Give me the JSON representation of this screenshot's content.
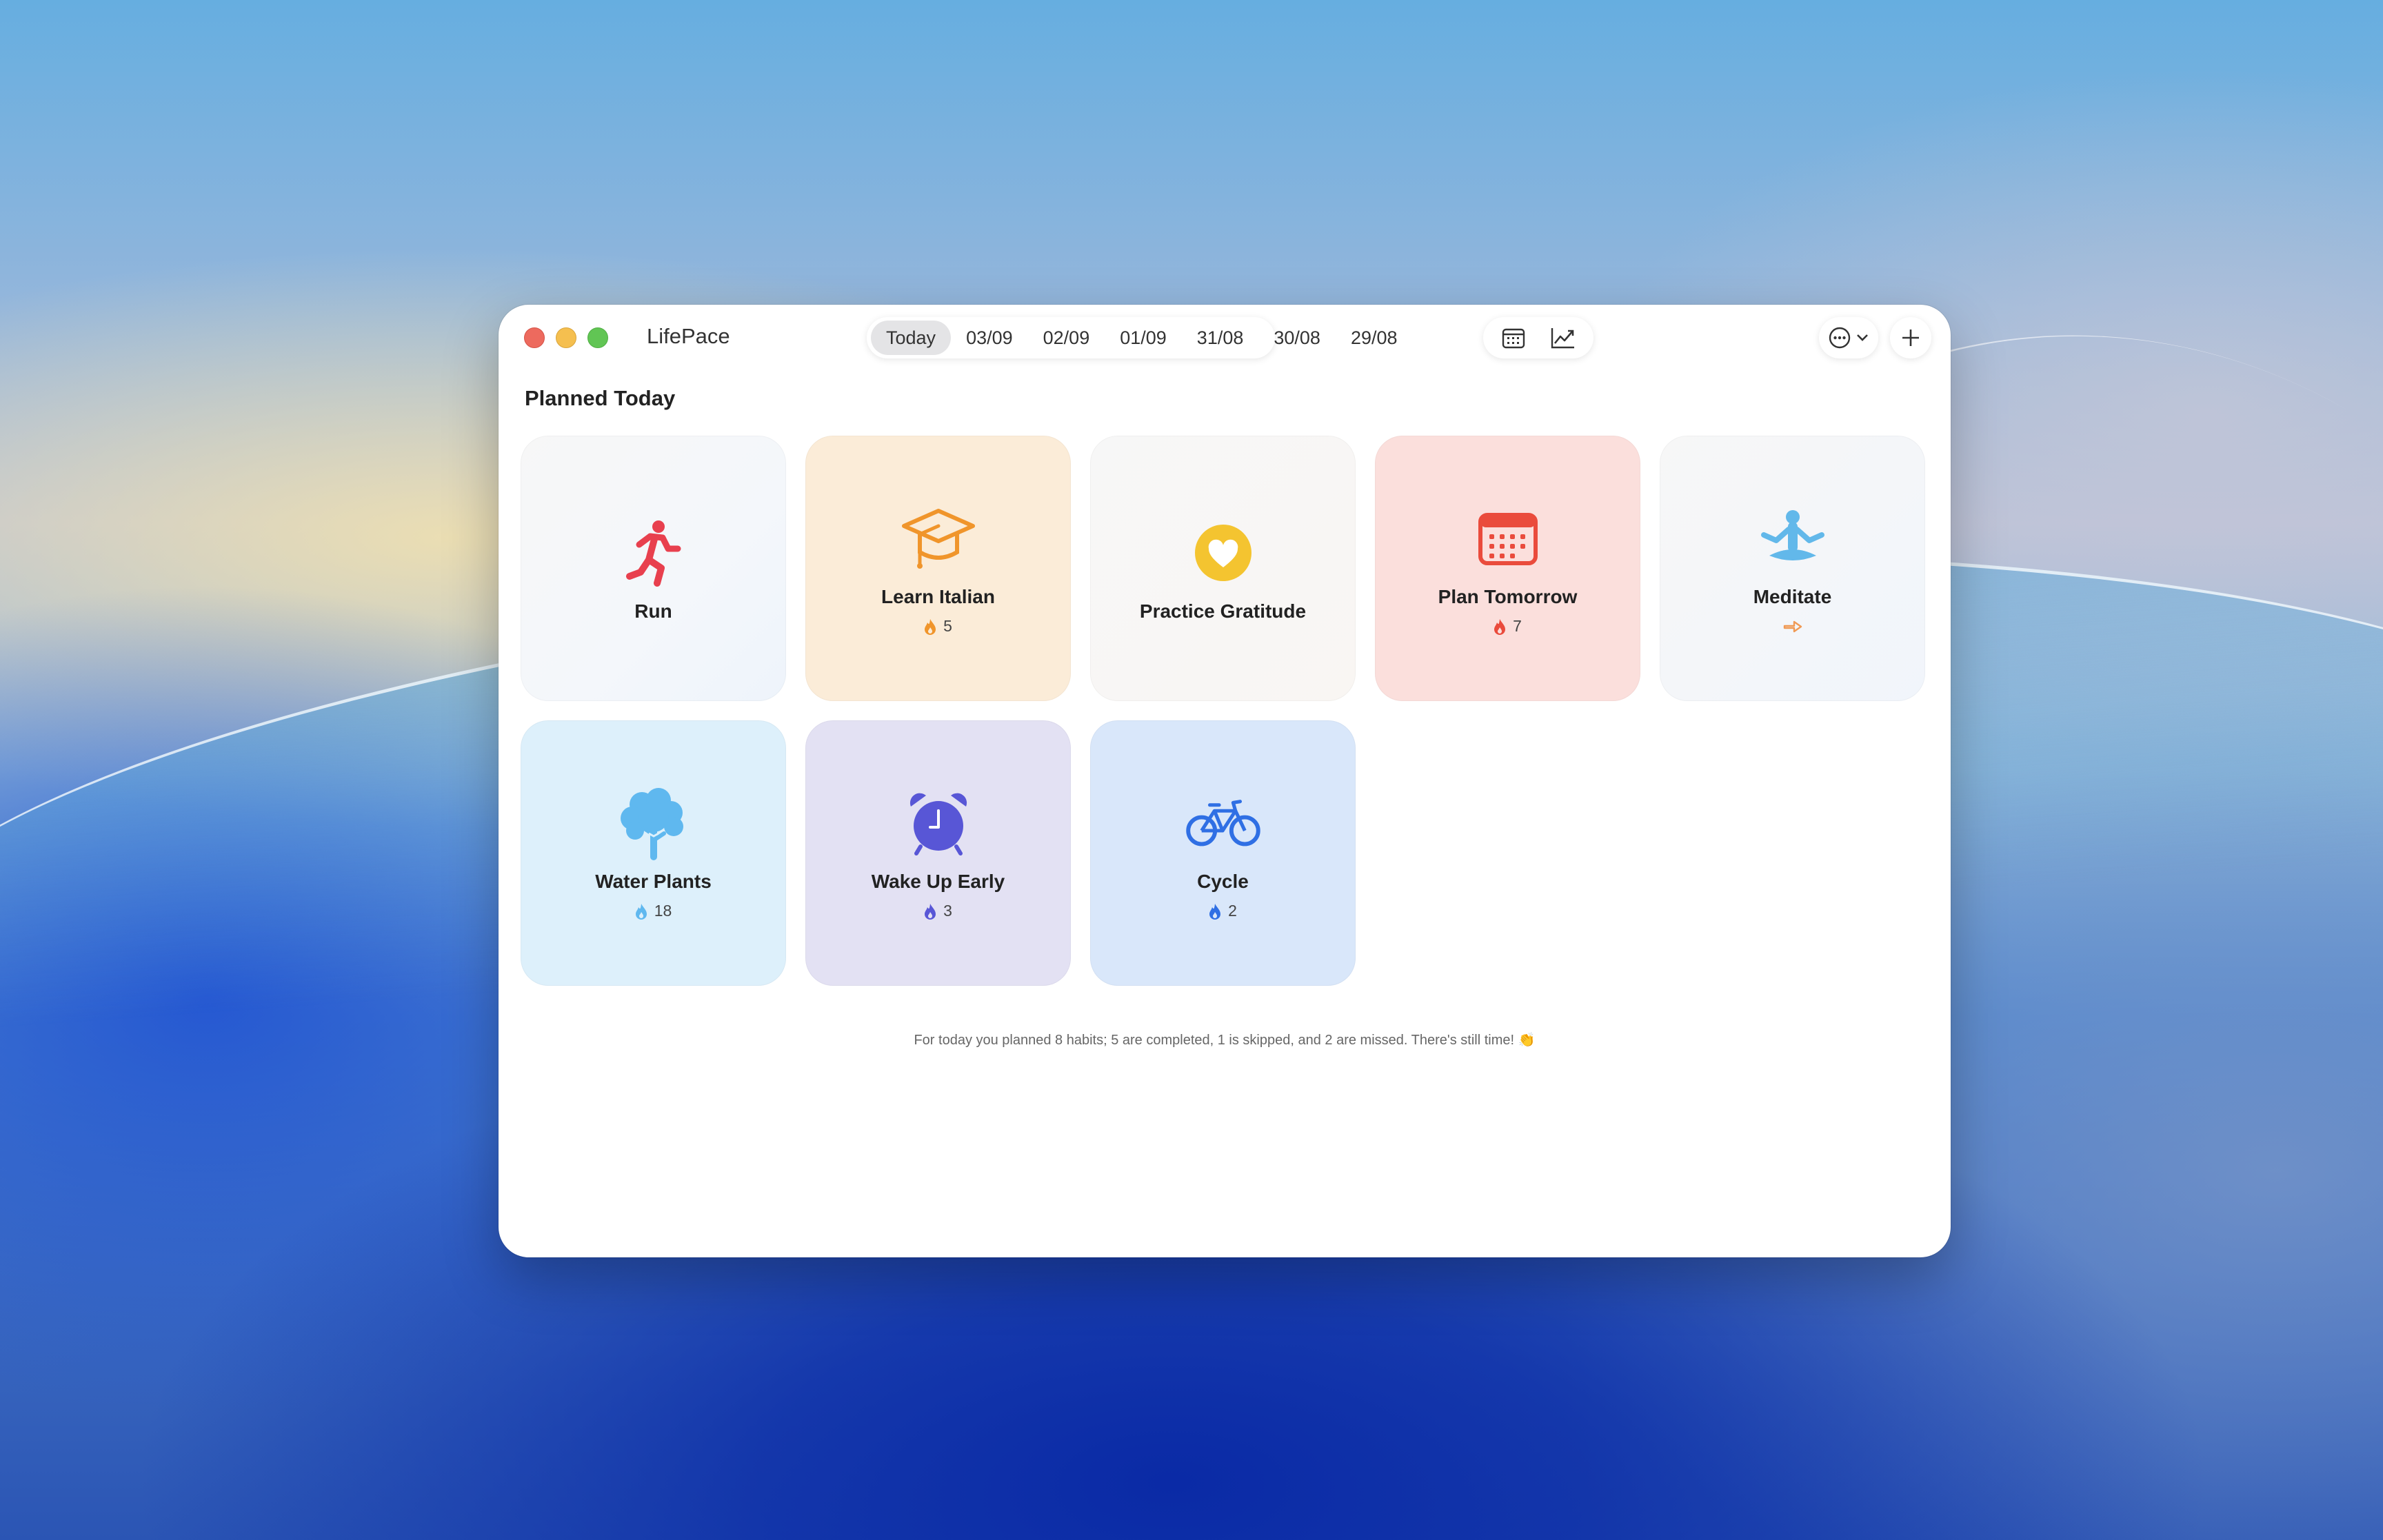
{
  "app": {
    "title": "LifePace"
  },
  "date_tabs": [
    "Today",
    "03/09",
    "02/09",
    "01/09",
    "31/08",
    "30/08",
    "29/08"
  ],
  "toolbar": {
    "calendar_icon": "calendar-icon",
    "chart_icon": "trend-chart-icon",
    "more_icon": "ellipsis-circle-icon",
    "add_icon": "plus-icon"
  },
  "section": {
    "title": "Planned Today"
  },
  "habits": [
    {
      "name": "Run",
      "streak": "",
      "icon": "running-figure-icon",
      "color": "#e8404e"
    },
    {
      "name": "Learn Italian",
      "streak": "5",
      "icon": "graduation-cap-icon",
      "color": "#f0952b"
    },
    {
      "name": "Practice Gratitude",
      "streak": "",
      "icon": "heart-circle-icon",
      "color": "#f4c430"
    },
    {
      "name": "Plan Tomorrow",
      "streak": "7",
      "icon": "calendar-icon",
      "color": "#ea4b3c"
    },
    {
      "name": "Meditate",
      "streak": "",
      "status_icon": "skip-arrow-icon",
      "icon": "meditation-figure-icon",
      "color": "#62b8ea"
    },
    {
      "name": "Water Plants",
      "streak": "18",
      "icon": "tree-icon",
      "color": "#5fb8ef"
    },
    {
      "name": "Wake Up Early",
      "streak": "3",
      "icon": "alarm-clock-icon",
      "color": "#5856d6"
    },
    {
      "name": "Cycle",
      "streak": "2",
      "icon": "bicycle-icon",
      "color": "#2f6fe4"
    }
  ],
  "summary": "For today you planned 8 habits; 5 are completed, 1 is skipped, and 2 are missed. There's still time! 👏"
}
